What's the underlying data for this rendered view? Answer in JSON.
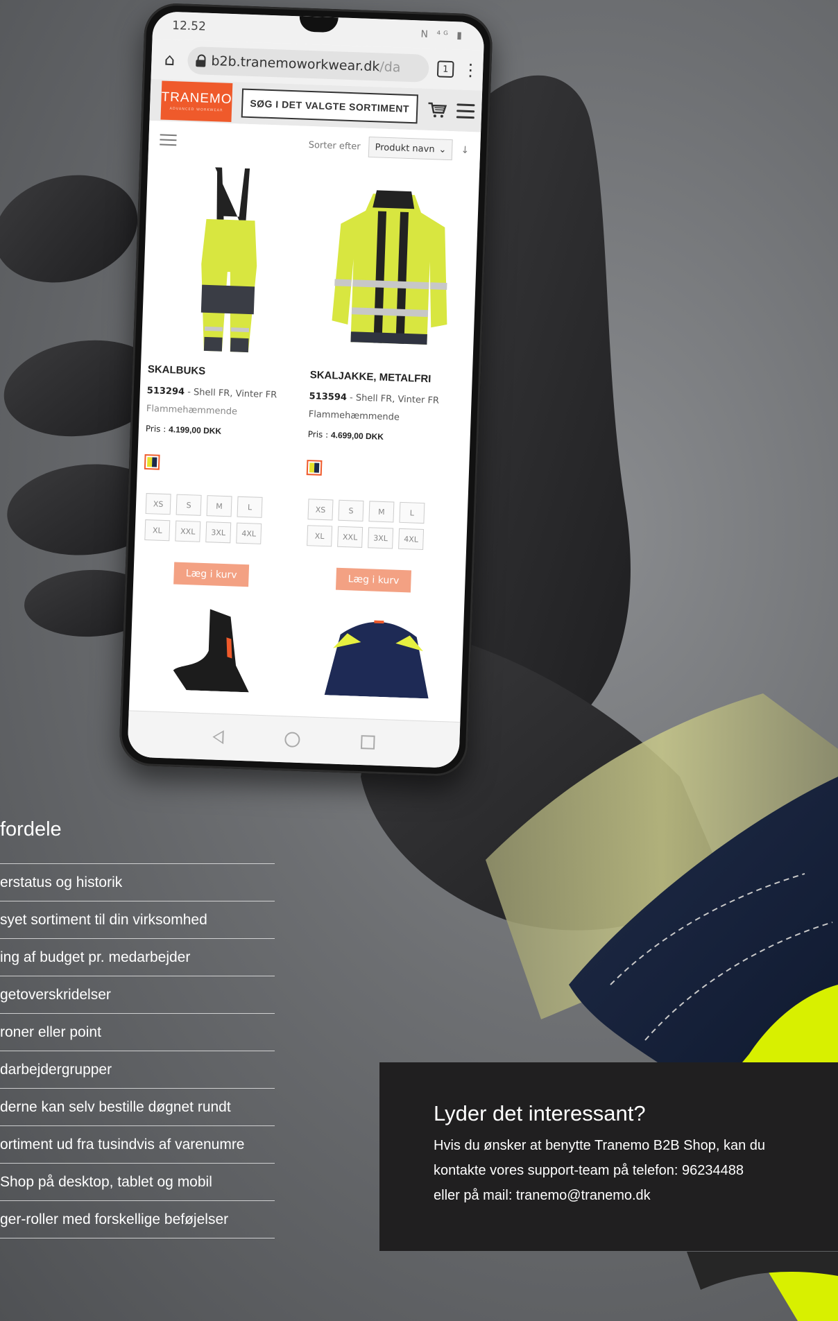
{
  "phone": {
    "status": {
      "time": "12.52",
      "icons": "N ⁴ᴳ ▮"
    },
    "browser": {
      "url_main": "b2b.tranemoworkwear.dk",
      "url_tail": "/da",
      "tab_count": "1"
    },
    "site": {
      "logo": "TRANEMO",
      "logo_sub": "ADVANCED WORKWEAR",
      "search_label": "SØG I DET VALGTE SORTIMENT"
    },
    "sort": {
      "label": "Sorter efter",
      "selected": "Produkt navn"
    },
    "products": [
      {
        "title": "SKALBUKS",
        "number": "513294",
        "desc": " - Shell FR, Vinter FR",
        "desc2": "Flammehæmmende",
        "price_label": "Pris : ",
        "price": "4.199,00 DKK",
        "sizes": [
          "XS",
          "S",
          "M",
          "L",
          "XL",
          "XXL",
          "3XL",
          "4XL"
        ],
        "button": "Læg i kurv"
      },
      {
        "title": "SKALJAKKE, METALFRI",
        "number": "513594",
        "desc": " - Shell FR, Vinter FR",
        "desc2": "Flammehæmmende",
        "price_label": "Pris : ",
        "price": "4.699,00 DKK",
        "sizes": [
          "XS",
          "S",
          "M",
          "L",
          "XL",
          "XXL",
          "3XL",
          "4XL"
        ],
        "button": "Læg i kurv"
      }
    ]
  },
  "fordele": {
    "title": "fordele",
    "items": [
      "erstatus og historik",
      "syet sortiment til din virksomhed",
      "ing af budget pr. medarbejder",
      "getoverskridelser",
      "roner eller point",
      "darbejdergrupper",
      "derne kan selv bestille døgnet rundt",
      "ortiment ud fra tusindvis af varenumre",
      " Shop på desktop, tablet og mobil",
      "ger-roller med forskellige beføjelser"
    ]
  },
  "info": {
    "title": "Lyder det interessant?",
    "line1": "Hvis du ønsker at benytte Tranemo B2B Shop, kan du",
    "line2": "kontakte vores support-team på telefon: 96234488",
    "line3": "eller på mail: tranemo@tranemo.dk"
  },
  "colors": {
    "brand": "#ef5a2b",
    "button": "#f3a183",
    "swatch_yellow": "#e6e12a",
    "swatch_navy": "#1b2a4a",
    "info_bg": "#201f20"
  }
}
